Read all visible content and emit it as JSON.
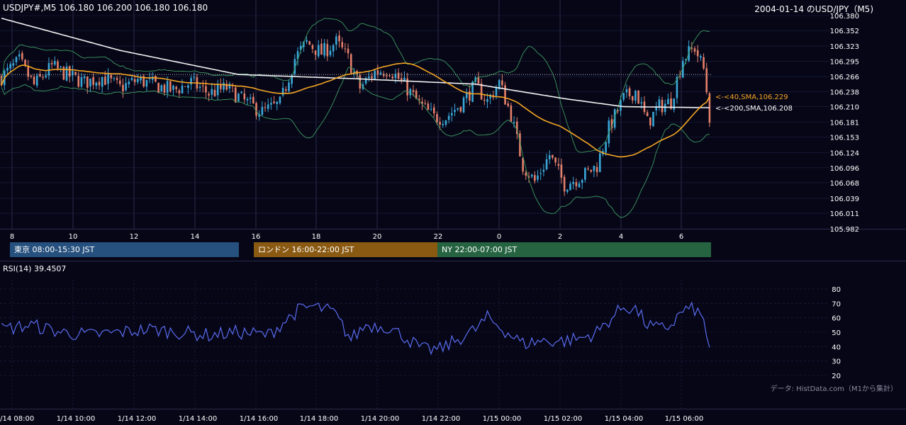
{
  "header": {
    "symbol_ohlc": "USDJPY#,M5 106.180 106.200 106.180 106.180",
    "title_right": "2004-01-14 のUSD/JPY（M5)"
  },
  "sessions": [
    {
      "label": "東京 08:00-15:30 JST",
      "color": "#26507d"
    },
    {
      "label": "ロンドン 16:00-22:00 JST",
      "color": "#8a5a12"
    },
    {
      "label": "NY 22:00-07:00 JST",
      "color": "#256341"
    }
  ],
  "rsi_label": "RSI(14) 39.4507",
  "credit": "データ: HistData.com（M1から集計）",
  "colors": {
    "background": "#060617",
    "bull": "#3aa8d8",
    "bear": "#e5806a",
    "sma40": "#f5a623",
    "sma200": "#f2f2f2",
    "bollinger": "#3e9b5f",
    "rsi": "#5b6cf0",
    "grid": "#1f2140"
  },
  "chart_data": [
    {
      "type": "candlestick",
      "title": "USDJPY#,M5",
      "ylim": [
        105.982,
        106.38
      ],
      "y_ticks": [
        "106.380",
        "106.352",
        "106.323",
        "106.295",
        "106.266",
        "106.238",
        "106.210",
        "106.181",
        "106.153",
        "106.124",
        "106.096",
        "106.068",
        "106.039",
        "106.011",
        "105.982"
      ],
      "x_ticks": [
        "8",
        "10",
        "12",
        "14",
        "16",
        "18",
        "20",
        "22",
        "0",
        "2",
        "4",
        "6"
      ],
      "max_line": 106.27,
      "series": [
        {
          "name": "SMA 40",
          "annotation": "<-<40,SMA,106.229",
          "last": 106.229
        },
        {
          "name": "SMA 200",
          "annotation": "<-<200,SMA,106.208",
          "last": 106.208
        },
        {
          "name": "Bollinger Bands"
        }
      ],
      "anchors": [
        {
          "i": 0,
          "v": 106.265
        },
        {
          "i": 6,
          "v": 106.295
        },
        {
          "i": 11,
          "v": 106.25
        },
        {
          "i": 17,
          "v": 106.285
        },
        {
          "i": 22,
          "v": 106.27
        },
        {
          "i": 28,
          "v": 106.255
        },
        {
          "i": 34,
          "v": 106.265
        },
        {
          "i": 40,
          "v": 106.245
        },
        {
          "i": 46,
          "v": 106.26
        },
        {
          "i": 52,
          "v": 106.25
        },
        {
          "i": 58,
          "v": 106.24
        },
        {
          "i": 64,
          "v": 106.255
        },
        {
          "i": 70,
          "v": 106.235
        },
        {
          "i": 76,
          "v": 106.245
        },
        {
          "i": 82,
          "v": 106.22
        },
        {
          "i": 88,
          "v": 106.2
        },
        {
          "i": 94,
          "v": 106.215
        },
        {
          "i": 99,
          "v": 106.3
        },
        {
          "i": 103,
          "v": 106.33
        },
        {
          "i": 108,
          "v": 106.31
        },
        {
          "i": 113,
          "v": 106.33
        },
        {
          "i": 117,
          "v": 106.3
        },
        {
          "i": 121,
          "v": 106.245
        },
        {
          "i": 126,
          "v": 106.275
        },
        {
          "i": 131,
          "v": 106.28
        },
        {
          "i": 136,
          "v": 106.25
        },
        {
          "i": 141,
          "v": 106.215
        },
        {
          "i": 146,
          "v": 106.19
        },
        {
          "i": 150,
          "v": 106.19
        },
        {
          "i": 155,
          "v": 106.215
        },
        {
          "i": 160,
          "v": 106.25
        },
        {
          "i": 164,
          "v": 106.22
        },
        {
          "i": 168,
          "v": 106.255
        },
        {
          "i": 172,
          "v": 106.195
        },
        {
          "i": 176,
          "v": 106.1
        },
        {
          "i": 180,
          "v": 106.07
        },
        {
          "i": 185,
          "v": 106.12
        },
        {
          "i": 190,
          "v": 106.065
        },
        {
          "i": 196,
          "v": 106.08
        },
        {
          "i": 201,
          "v": 106.1
        },
        {
          "i": 205,
          "v": 106.17
        },
        {
          "i": 210,
          "v": 106.225
        },
        {
          "i": 214,
          "v": 106.24
        },
        {
          "i": 218,
          "v": 106.18
        },
        {
          "i": 222,
          "v": 106.21
        },
        {
          "i": 226,
          "v": 106.22
        },
        {
          "i": 230,
          "v": 106.3
        },
        {
          "i": 234,
          "v": 106.32
        },
        {
          "i": 237,
          "v": 106.28
        },
        {
          "i": 239,
          "v": 106.2
        }
      ],
      "candle_count": 240
    },
    {
      "type": "line",
      "title": "RSI(14)",
      "last": 39.4507,
      "ylim": [
        20,
        80
      ],
      "y_ticks": [
        "80",
        "70",
        "60",
        "50",
        "40",
        "30",
        "20"
      ],
      "x_ticks": [
        "1/14 08:00",
        "1/14 10:00",
        "1/14 12:00",
        "1/14 14:00",
        "1/14 16:00",
        "1/14 18:00",
        "1/14 20:00",
        "1/14 22:00",
        "1/15 00:00",
        "1/15 02:00",
        "1/15 04:00",
        "1/15 06:00"
      ],
      "anchors": [
        {
          "i": 0,
          "v": 52
        },
        {
          "i": 10,
          "v": 55
        },
        {
          "i": 20,
          "v": 50
        },
        {
          "i": 30,
          "v": 48
        },
        {
          "i": 40,
          "v": 50
        },
        {
          "i": 50,
          "v": 52
        },
        {
          "i": 60,
          "v": 50
        },
        {
          "i": 70,
          "v": 48
        },
        {
          "i": 80,
          "v": 50
        },
        {
          "i": 90,
          "v": 48
        },
        {
          "i": 100,
          "v": 65
        },
        {
          "i": 105,
          "v": 68
        },
        {
          "i": 112,
          "v": 64
        },
        {
          "i": 118,
          "v": 45
        },
        {
          "i": 123,
          "v": 55
        },
        {
          "i": 130,
          "v": 54
        },
        {
          "i": 136,
          "v": 47
        },
        {
          "i": 142,
          "v": 38
        },
        {
          "i": 148,
          "v": 38
        },
        {
          "i": 154,
          "v": 45
        },
        {
          "i": 160,
          "v": 52
        },
        {
          "i": 164,
          "v": 60
        },
        {
          "i": 168,
          "v": 54
        },
        {
          "i": 172,
          "v": 48
        },
        {
          "i": 176,
          "v": 42
        },
        {
          "i": 182,
          "v": 44
        },
        {
          "i": 190,
          "v": 44
        },
        {
          "i": 196,
          "v": 46
        },
        {
          "i": 201,
          "v": 50
        },
        {
          "i": 206,
          "v": 60
        },
        {
          "i": 210,
          "v": 68
        },
        {
          "i": 214,
          "v": 66
        },
        {
          "i": 218,
          "v": 55
        },
        {
          "i": 222,
          "v": 52
        },
        {
          "i": 226,
          "v": 55
        },
        {
          "i": 230,
          "v": 65
        },
        {
          "i": 234,
          "v": 66
        },
        {
          "i": 237,
          "v": 58
        },
        {
          "i": 239,
          "v": 39.45
        }
      ]
    }
  ]
}
